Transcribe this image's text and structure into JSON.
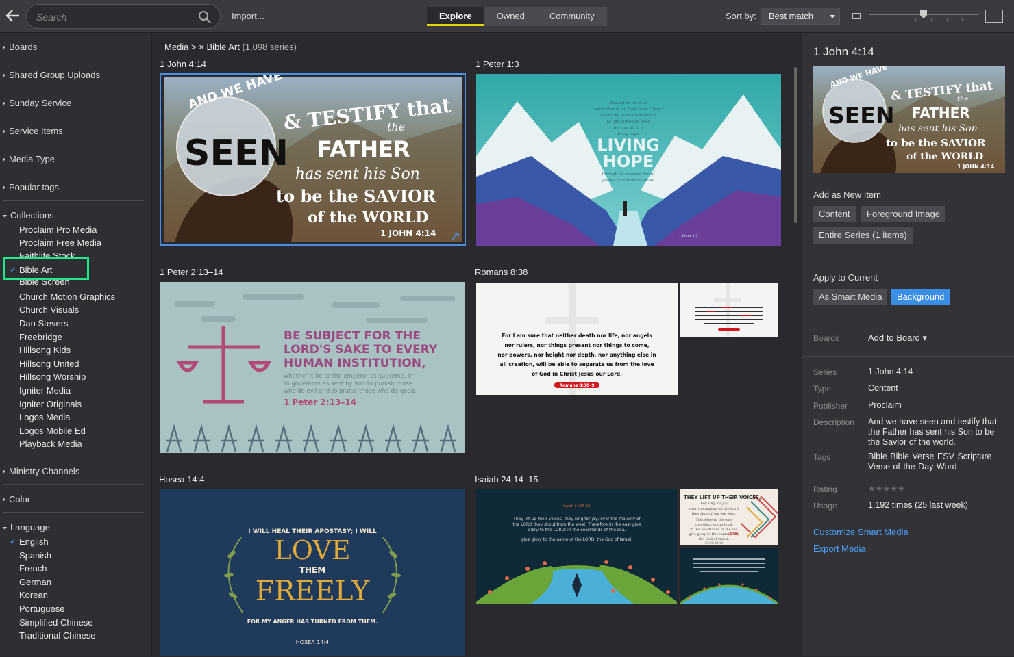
{
  "topbar": {
    "search_placeholder": "Search",
    "import_label": "Import...",
    "tabs": [
      "Explore",
      "Owned",
      "Community"
    ],
    "sort_label": "Sort by:",
    "sort_value": "Best match"
  },
  "sidebar": {
    "sections": [
      "Boards",
      "Shared Group Uploads",
      "Sunday Service",
      "Service Items",
      "Media Type",
      "Popular tags",
      "Collections",
      "Ministry Channels",
      "Color",
      "Language"
    ],
    "collections": [
      "Proclaim Pro Media",
      "Proclaim Free Media",
      "Faithlife Stock",
      "Bible Art",
      "Bible Screen",
      "Church Motion Graphics",
      "Church Visuals",
      "Dan Stevers",
      "Freebridge",
      "Hillsong Kids",
      "Hillsong United",
      "Hillsong Worship",
      "Igniter Media",
      "Igniter Originals",
      "Logos Media",
      "Logos Mobile Ed",
      "Playback Media"
    ],
    "languages": [
      "English",
      "Spanish",
      "French",
      "German",
      "Korean",
      "Portuguese",
      "Simplified Chinese",
      "Traditional Chinese"
    ],
    "check": "✓"
  },
  "main": {
    "breadcrumb_root": "Media >",
    "breadcrumb_filter": "× Bible Art",
    "breadcrumb_count": "(1,098 series)",
    "cards": [
      "1 John 4:14",
      "1 Peter 1:3",
      "1 Peter 2:13–14",
      "Romans 8:38",
      "Hosea 14:4",
      "Isaiah 24:14–15"
    ],
    "art": {
      "seen": [
        "AND WE HAVE",
        "SEEN",
        "& TESTIFY that",
        "the",
        "FATHER",
        "has sent his Son",
        "to be the SAVIOR",
        "of the WORLD",
        "1 JOHN 4:14"
      ],
      "living_hope": [
        "LIVING",
        "HOPE",
        "Blessed be the God",
        "and Father of our Lord Jesus Christ!",
        "According to his great mercy,",
        "he has caused us to be",
        "born again to a",
        "living hope",
        "through the resurrection of",
        "Jesus Christ from the dead.",
        "1 Peter 1:3"
      ],
      "peter": [
        "BE SUBJECT FOR THE",
        "LORD'S SAKE TO EVERY",
        "HUMAN INSTITUTION,",
        "whether it be to the emperor as supreme, or",
        "to governors as sent by him to punish those",
        "who do evil and to praise those who do good.",
        "1 Peter 2:13–14"
      ],
      "romans": [
        "For I am sure that neither death nor life, nor angels",
        "nor rulers, nor things present nor things to come,",
        "nor powers, nor height nor depth, nor anything else in",
        "all creation, will be able to separate us from the love",
        "of God in Christ Jesus our Lord.",
        "Romans 8:38–9"
      ],
      "hosea": [
        "I WILL HEAL THEIR APOSTASY; I WILL",
        "LOVE",
        "THEM",
        "FREELY",
        "FOR MY ANGER HAS TURNED FROM THEM.",
        "HOSEA 14:4"
      ],
      "isaiah": [
        "Isaiah 24:14–15",
        "They lift up their voices, they sing for joy; over the majesty of",
        "the LORD they shout from the west. Therefore in the east give",
        "glory to the LORD; in the coastlands of the sea,",
        "give glory to the name of the LORD, the God of Israel.",
        "THEY LIFT UP THEIR VOICES,",
        "they sing for joy;",
        "over the majesty of the Lord",
        "they shout from the west.",
        "Therefore in the east",
        "give glory to the Lord;",
        "in the coastlands of the sea",
        "give glory to the name of the",
        "LORD,",
        "the God of Israel.",
        "ISAIAH 24:14"
      ]
    }
  },
  "panel": {
    "title": "1 John 4:14",
    "add_heading": "Add as New Item",
    "add_buttons": [
      "Content",
      "Foreground Image",
      "Entire Series (1 items)"
    ],
    "apply_heading": "Apply to Current",
    "apply_buttons": [
      "As Smart Media",
      "Background"
    ],
    "boards_label": "Boards",
    "add_to_board": "Add to Board ▾",
    "details": [
      {
        "label": "Series",
        "value": "1 John 4:14"
      },
      {
        "label": "Type",
        "value": "Content"
      },
      {
        "label": "Publisher",
        "value": "Proclaim"
      },
      {
        "label": "Description",
        "value": "And we have seen and testify that the Father has sent his Son to be the Savior of the world."
      },
      {
        "label": "Tags",
        "value": "Bible  Bible Verse  ESV  Scripture  Verse of the Day  Word"
      },
      {
        "label": "Rating",
        "value": ""
      },
      {
        "label": "Usage",
        "value": "1,192 times (25 last week)"
      }
    ],
    "rating_stars": "★★★★★",
    "links": [
      "Customize Smart Media",
      "Export Media"
    ]
  },
  "colors": {
    "accent": "#e8d600",
    "link": "#4da3ff",
    "highlight": "#1eea8a",
    "blue_button": "#3a8ee6"
  }
}
